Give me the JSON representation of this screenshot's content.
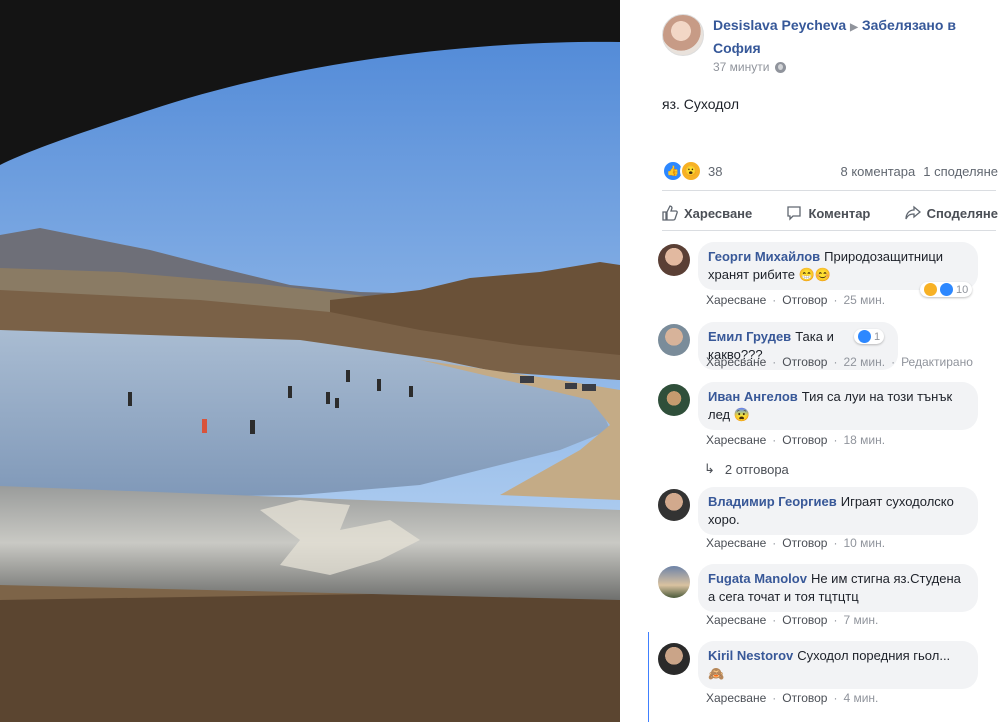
{
  "post": {
    "author": "Desislava Peycheva",
    "location": "Забелязано в София",
    "time": "37 минути",
    "text": "яз. Суходол",
    "reaction_count": "38",
    "comments_count": "8 коментара",
    "shares_count": "1 споделяне",
    "accent": "#365899"
  },
  "actions": {
    "like": "Харесване",
    "comment": "Коментар",
    "share": "Споделяне"
  },
  "meta_labels": {
    "like": "Харесване",
    "reply": "Отговор"
  },
  "comments": [
    {
      "author": "Георги Михайлов",
      "text": "Природозащитници хранят рибите 😁😊",
      "time": "25 мин.",
      "reactions": "10"
    },
    {
      "author": "Емил Грудев",
      "text": "Така и какво???",
      "time": "22 мин.",
      "edited": "Редактирано",
      "reactions": "1"
    },
    {
      "author": "Иван Ангелов",
      "text": "Тия са луи на този тънък лед 😨",
      "time": "18 мин."
    },
    {
      "author": "Владимир Георгиев",
      "text": "Играят суходолско хоро.",
      "time": "10 мин."
    },
    {
      "author": "Fugata Manolov",
      "text": "Не им стигна яз.Студена а сега точат и тоя тцтцтц",
      "time": "7 мин."
    },
    {
      "author": "Kiril Nestorov",
      "text": "Суходол поредния гьол... 🙈",
      "time": "4 мин."
    }
  ],
  "replies_label": "2 отговора",
  "icons": [
    "like-icon",
    "wow-icon",
    "comment-icon",
    "share-icon",
    "globe-icon",
    "reply-arrow-icon",
    "haha-icon"
  ]
}
